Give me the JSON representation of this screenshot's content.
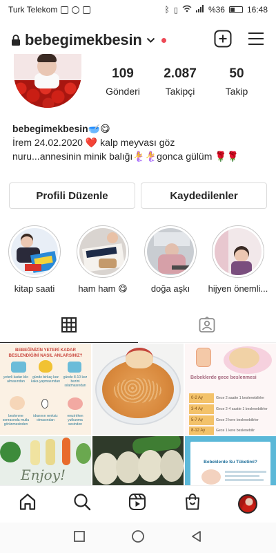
{
  "status_bar": {
    "carrier": "Turk Telekom",
    "battery_percent": "%36",
    "battery_level": 0.36,
    "time": "16:48"
  },
  "header": {
    "username": "bebegimekbesin",
    "icons": [
      "lock-icon",
      "chevron-down-icon",
      "new-post-icon",
      "menu-icon"
    ]
  },
  "profile": {
    "stats": [
      {
        "value": "109",
        "label": "Gönderi"
      },
      {
        "value": "2.087",
        "label": "Takipçi"
      },
      {
        "value": "50",
        "label": "Takip"
      }
    ],
    "bio_name": "bebegimekbesin🥣😋",
    "bio_line1": "İrem 24.02.2020 ❤️ kalp meyvası göz",
    "bio_line2": "nuru...annesinin minik balığı🧜‍♀️🧜‍♀️gonca gülüm 🌹🌹"
  },
  "buttons": {
    "edit_profile": "Profili Düzenle",
    "saved": "Kaydedilenler"
  },
  "highlights": [
    {
      "label": "kitap saati"
    },
    {
      "label": "ham ham 😋"
    },
    {
      "label": "doğa aşkı"
    },
    {
      "label": "hijyen önemli..."
    }
  ],
  "tabs": [
    "grid-icon",
    "tagged-icon"
  ],
  "posts": {
    "post1": {
      "title": "BEBEĞİNİZİN YETERİ KADAR BESLENDİĞİNİ NASIL ANLARSINIZ?",
      "cells": [
        "yeterli kadar kilo almasından",
        "günde birkaç kez kaka yapmasından",
        "günde 8-10 kez bezini ıslatmasından",
        "beslenme sonrasında mutlu görünmesinden",
        "idrarının renksiz olmasından",
        "emzirirken yutkunma sesinden"
      ]
    },
    "post3": {
      "title": "Bebeklerde gece beslenmesi",
      "rows": [
        {
          "age": "0-2 Ay",
          "text": "Gece 2 saatte 1 beslenebilirler"
        },
        {
          "age": "3-4 Ay",
          "text": "Gece 2-4 saatte 1 beslenebilirler"
        },
        {
          "age": "5-7 Ay",
          "text": "Gece 2 kere beslenebilirler"
        },
        {
          "age": "8-12 Ay",
          "text": "Gece 1 kere beslenebilir"
        }
      ]
    },
    "post4": {
      "text": "Enjoy!"
    },
    "post6": {
      "title": "Bebeklerde Su Tüketimi?"
    }
  },
  "bottom_nav": [
    "home-icon",
    "search-icon",
    "reels-icon",
    "shop-icon",
    "profile-avatar"
  ],
  "android_nav": [
    "recents-button",
    "home-button",
    "back-button"
  ]
}
